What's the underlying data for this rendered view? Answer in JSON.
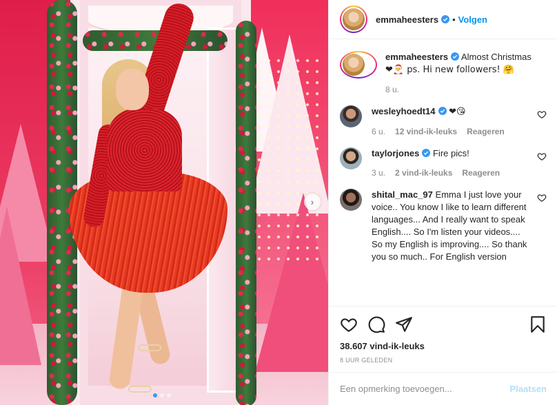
{
  "post": {
    "username": "emmaheesters",
    "follow_label": "Volgen",
    "follow_separator": "•",
    "caption_text": "Almost Christmas",
    "caption_emojis_line2": "❤🎅 ps. Hi new followers! 🤗",
    "caption_time": "8 u.",
    "likes": "38.607 vind-ik-leuks",
    "time_ago": "8 UUR GELEDEN",
    "carousel": {
      "slides": 3,
      "active_index": 0
    }
  },
  "comments": [
    {
      "username": "wesleyhoedt14",
      "verified": true,
      "text": "❤😘",
      "time": "6 u.",
      "likes": "12 vind-ik-leuks",
      "reply_label": "Reageren"
    },
    {
      "username": "taylorjones",
      "verified": true,
      "text": "Fire pics!",
      "time": "3 u.",
      "likes": "2 vind-ik-leuks",
      "reply_label": "Reageren"
    },
    {
      "username": "shital_mac_97",
      "verified": false,
      "text": "Emma I just love your voice.. You know I like to learn different languages... And I really want to speak English.... So I'm listen your videos.... So my English is improving.... So thank you so much.. For English version"
    }
  ],
  "add_comment": {
    "placeholder": "Een opmerking toevoegen...",
    "post_label": "Plaatsen"
  },
  "colors": {
    "link_blue": "#0095f6",
    "verified_blue": "#3897f0",
    "post_disabled": "#b2dffc",
    "heart_red": "#ed4956"
  },
  "icons": [
    "chevron-right-icon",
    "verified-icon",
    "heart-outline-icon",
    "comment-icon",
    "share-icon",
    "bookmark-icon"
  ]
}
